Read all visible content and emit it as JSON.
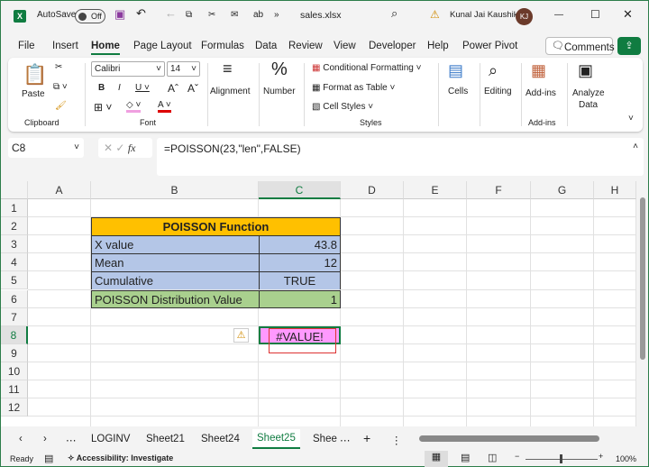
{
  "titlebar": {
    "autosave": "AutoSave",
    "toggle": "Off",
    "filename": "sales.xlsx",
    "user": "Kunal Jai Kaushik",
    "initials": "KJ"
  },
  "menu": {
    "items": [
      "File",
      "Insert",
      "Home",
      "Page Layout",
      "Formulas",
      "Data",
      "Review",
      "View",
      "Developer",
      "Help",
      "Power Pivot"
    ],
    "active": "Home",
    "comments": "Comments"
  },
  "ribbon": {
    "paste": "Paste",
    "clipboard": "Clipboard",
    "font_name": "Calibri",
    "font_size": "14",
    "font": "Font",
    "alignment": "Alignment",
    "number": "Number",
    "conditional": "Conditional Formatting",
    "format_table": "Format as Table",
    "cell_styles": "Cell Styles",
    "styles": "Styles",
    "cells": "Cells",
    "editing": "Editing",
    "addins": "Add-ins",
    "addins_group": "Add-ins",
    "analyze": "Analyze",
    "analyze2": "Data"
  },
  "formula_bar": {
    "name_box": "C8",
    "formula": "=POISSON(23,\"len\",FALSE)"
  },
  "columns": [
    "A",
    "B",
    "C",
    "D",
    "E",
    "F",
    "G",
    "H"
  ],
  "rows": [
    "1",
    "2",
    "3",
    "4",
    "5",
    "6",
    "7",
    "8",
    "9",
    "10",
    "11",
    "12"
  ],
  "table": {
    "title": "POISSON Function",
    "rows": [
      {
        "label": "X value",
        "value": "43.8"
      },
      {
        "label": "Mean",
        "value": "12"
      },
      {
        "label": "Cumulative",
        "value": "TRUE"
      },
      {
        "label": "POISSON Distribution Value",
        "value": "1"
      }
    ]
  },
  "c8": "#VALUE!",
  "colors": {
    "header": "#ffc000",
    "blue": "#b4c6e7",
    "green": "#a9d08e",
    "pink": "#ff99ff",
    "excel": "#107c41"
  },
  "sheets": [
    "LOGINV",
    "Sheet21",
    "Sheet24",
    "Sheet25",
    "Shee"
  ],
  "active_sheet": "Sheet25",
  "status": {
    "ready": "Ready",
    "accessibility": "Accessibility: Investigate",
    "zoom": "100%"
  }
}
